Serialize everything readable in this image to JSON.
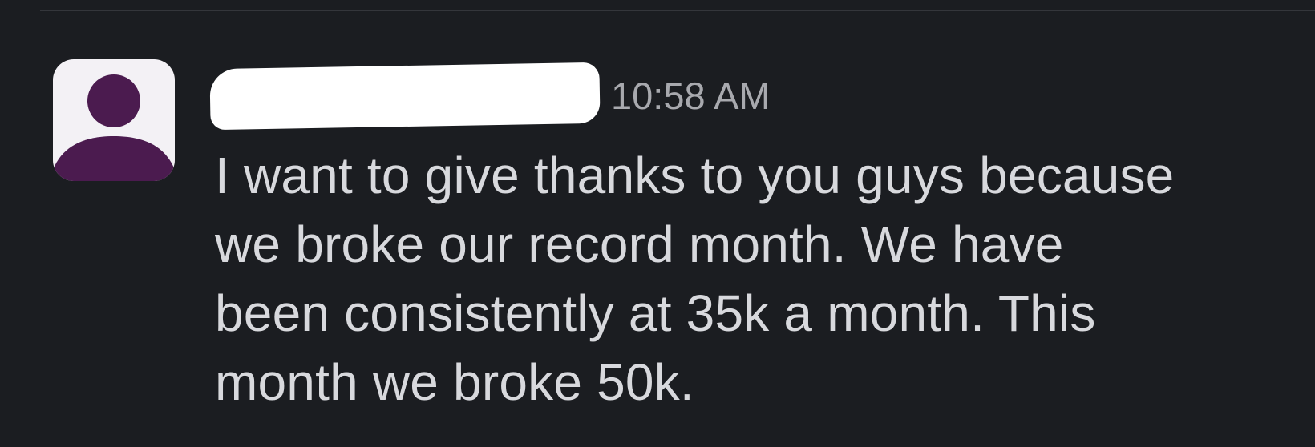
{
  "message": {
    "sender_name": "",
    "timestamp": "10:58 AM",
    "lines": [
      "I want to give thanks to you guys because",
      "we broke our record month. We have",
      "been consistently at 35k a month. This",
      "month we broke 50k."
    ],
    "avatar_icon": "person-icon",
    "colors": {
      "background": "#1b1d21",
      "avatar_background": "#f3f1f5",
      "avatar_figure": "#4b1b4f",
      "timestamp": "#a8a9ae",
      "message_text": "#d8d9dd",
      "redaction": "#ffffff"
    }
  }
}
